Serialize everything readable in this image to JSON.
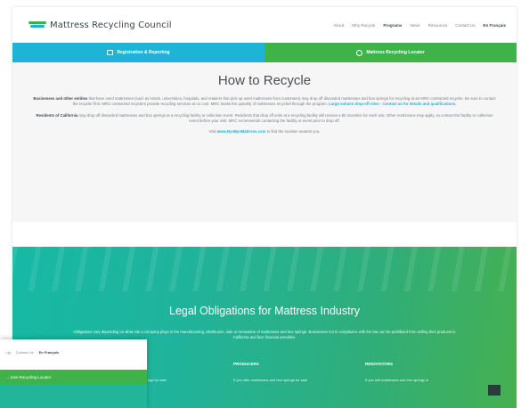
{
  "header": {
    "logo_text": "Mattress Recycling Council",
    "nav": [
      "About",
      "Why Recycle",
      "Programs",
      "News",
      "Resources",
      "Contact Us",
      "En Français"
    ],
    "active_nav": "Programs"
  },
  "bars": {
    "left_label": "Registration & Reporting",
    "right_label": "Mattress Recycling Locator"
  },
  "main": {
    "title": "How to Recycle",
    "para1_lead": "Businesses and other entities",
    "para1_text": " that have used mattresses (such as hotels, universities, hospitals, and retailers that pick up used mattresses from customers) may drop off discarded mattresses and box springs for recycling at an MRC-contracted recycler. Be sure to contact the recycler first. MRC-contracted recyclers provide recycling services at no cost. MRC tracks the quantity of mattresses recycled through the program.",
    "para1_link": "Large volume drop-off sites - Contact us for details and qualifications.",
    "para2_lead": "Residents of California",
    "para2_text": " may drop off discarded mattresses and box springs at a recycling facility or collection event. Residents that drop off units at a recycling facility will receive a $4 incentive for each unit. Other restrictions may apply, so contact the facility or collection event before your visit. MRC recommends contacting the facility or event prior to drop off.",
    "para3_pre": "Visit ",
    "para3_link": "www.ByeByeMattress.com",
    "para3_post": " to find the location nearest you."
  },
  "hero": {
    "title": "Legal Obligations for Mattress Industry",
    "text": "Obligations vary depending on what role a company plays in the manufacturing, distribution, sale or renovation of mattresses and box springs. Businesses not in compliance with the law can be prohibited from selling their products in California and face financial penalties.",
    "columns": [
      {
        "heading": "PRODUCERS",
        "text": "If you offer mattresses and box springs for sale"
      },
      {
        "heading": "RENOVATORS",
        "text": "If you sell mattresses and box springs in"
      }
    ],
    "left_text": "ngs for sale"
  },
  "inset": {
    "nav": [
      "...ng",
      "Contact Us",
      "En Français"
    ],
    "active_nav": "En Français",
    "green_bar_label": "...ress Recycling Locator",
    "teal_text": ""
  }
}
